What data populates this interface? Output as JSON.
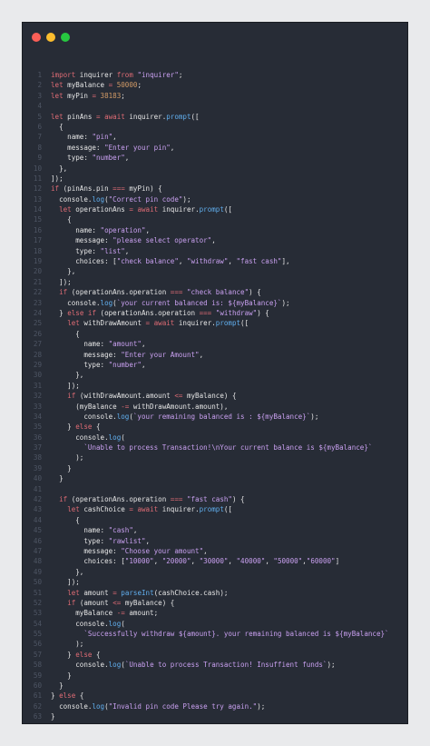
{
  "window": {
    "buttons": [
      {
        "name": "close",
        "color": "#fb5f57"
      },
      {
        "name": "minimize",
        "color": "#fbbd2e"
      },
      {
        "name": "maximize",
        "color": "#27c840"
      }
    ]
  },
  "colors": {
    "keyword": "#e06c75",
    "string": "#c9a0f0",
    "number": "#d19a66",
    "function": "#61afef",
    "text": "#e6e6e6",
    "line_number": "#4e5564",
    "background": "#272c36"
  },
  "code_lines": [
    [
      [
        "k",
        "import"
      ],
      [
        "i",
        " inquirer "
      ],
      [
        "k",
        "from"
      ],
      [
        "i",
        " "
      ],
      [
        "s",
        "\"inquirer\""
      ],
      [
        "i",
        ";"
      ]
    ],
    [
      [
        "k",
        "let"
      ],
      [
        "i",
        " myBalance "
      ],
      [
        "k",
        "="
      ],
      [
        "i",
        " "
      ],
      [
        "n",
        "50000"
      ],
      [
        "i",
        ";"
      ]
    ],
    [
      [
        "k",
        "let"
      ],
      [
        "i",
        " myPin "
      ],
      [
        "k",
        "="
      ],
      [
        "i",
        " "
      ],
      [
        "n",
        "38183"
      ],
      [
        "i",
        ";"
      ]
    ],
    [],
    [
      [
        "k",
        "let"
      ],
      [
        "i",
        " pinAns "
      ],
      [
        "k",
        "="
      ],
      [
        "i",
        " "
      ],
      [
        "k",
        "await"
      ],
      [
        "i",
        " inquirer."
      ],
      [
        "f",
        "prompt"
      ],
      [
        "i",
        "(["
      ]
    ],
    [
      [
        "i",
        "  {"
      ]
    ],
    [
      [
        "i",
        "    name: "
      ],
      [
        "s",
        "\"pin\""
      ],
      [
        "i",
        ","
      ]
    ],
    [
      [
        "i",
        "    message: "
      ],
      [
        "s",
        "\"Enter your pin\""
      ],
      [
        "i",
        ","
      ]
    ],
    [
      [
        "i",
        "    type: "
      ],
      [
        "s",
        "\"number\""
      ],
      [
        "i",
        ","
      ]
    ],
    [
      [
        "i",
        "  },"
      ]
    ],
    [
      [
        "i",
        "]);"
      ]
    ],
    [
      [
        "k",
        "if"
      ],
      [
        "i",
        " (pinAns.pin "
      ],
      [
        "k",
        "==="
      ],
      [
        "i",
        " myPin) {"
      ]
    ],
    [
      [
        "i",
        "  console."
      ],
      [
        "f",
        "log"
      ],
      [
        "i",
        "("
      ],
      [
        "s",
        "\"Correct pin code\""
      ],
      [
        "i",
        ");"
      ]
    ],
    [
      [
        "i",
        "  "
      ],
      [
        "k",
        "let"
      ],
      [
        "i",
        " operationAns "
      ],
      [
        "k",
        "="
      ],
      [
        "i",
        " "
      ],
      [
        "k",
        "await"
      ],
      [
        "i",
        " inquirer."
      ],
      [
        "f",
        "prompt"
      ],
      [
        "i",
        "(["
      ]
    ],
    [
      [
        "i",
        "    {"
      ]
    ],
    [
      [
        "i",
        "      name: "
      ],
      [
        "s",
        "\"operation\""
      ],
      [
        "i",
        ","
      ]
    ],
    [
      [
        "i",
        "      message: "
      ],
      [
        "s",
        "\"please select operator\""
      ],
      [
        "i",
        ","
      ]
    ],
    [
      [
        "i",
        "      type: "
      ],
      [
        "s",
        "\"list\""
      ],
      [
        "i",
        ","
      ]
    ],
    [
      [
        "i",
        "      choices: ["
      ],
      [
        "s",
        "\"check balance\""
      ],
      [
        "i",
        ", "
      ],
      [
        "s",
        "\"withdraw\""
      ],
      [
        "i",
        ", "
      ],
      [
        "s",
        "\"fast cash\""
      ],
      [
        "i",
        "],"
      ]
    ],
    [
      [
        "i",
        "    },"
      ]
    ],
    [
      [
        "i",
        "  ]);"
      ]
    ],
    [
      [
        "i",
        "  "
      ],
      [
        "k",
        "if"
      ],
      [
        "i",
        " (operationAns.operation "
      ],
      [
        "k",
        "==="
      ],
      [
        "i",
        " "
      ],
      [
        "s",
        "\"check balance\""
      ],
      [
        "i",
        ") {"
      ]
    ],
    [
      [
        "i",
        "    console."
      ],
      [
        "f",
        "log"
      ],
      [
        "i",
        "("
      ],
      [
        "t",
        "`your current balanced is: ${myBalance}`"
      ],
      [
        "i",
        ");"
      ]
    ],
    [
      [
        "i",
        "  } "
      ],
      [
        "k",
        "else if"
      ],
      [
        "i",
        " (operationAns.operation "
      ],
      [
        "k",
        "==="
      ],
      [
        "i",
        " "
      ],
      [
        "s",
        "\"withdraw\""
      ],
      [
        "i",
        ") {"
      ]
    ],
    [
      [
        "i",
        "    "
      ],
      [
        "k",
        "let"
      ],
      [
        "i",
        " withDrawAmount "
      ],
      [
        "k",
        "="
      ],
      [
        "i",
        " "
      ],
      [
        "k",
        "await"
      ],
      [
        "i",
        " inquirer."
      ],
      [
        "f",
        "prompt"
      ],
      [
        "i",
        "(["
      ]
    ],
    [
      [
        "i",
        "      {"
      ]
    ],
    [
      [
        "i",
        "        name: "
      ],
      [
        "s",
        "\"amount\""
      ],
      [
        "i",
        ","
      ]
    ],
    [
      [
        "i",
        "        message: "
      ],
      [
        "s",
        "\"Enter your Amount\""
      ],
      [
        "i",
        ","
      ]
    ],
    [
      [
        "i",
        "        type: "
      ],
      [
        "s",
        "\"number\""
      ],
      [
        "i",
        ","
      ]
    ],
    [
      [
        "i",
        "      },"
      ]
    ],
    [
      [
        "i",
        "    ]);"
      ]
    ],
    [
      [
        "i",
        "    "
      ],
      [
        "k",
        "if"
      ],
      [
        "i",
        " (withDrawAmount.amount "
      ],
      [
        "k",
        "<="
      ],
      [
        "i",
        " myBalance) {"
      ]
    ],
    [
      [
        "i",
        "      (myBalance "
      ],
      [
        "k",
        "-="
      ],
      [
        "i",
        " withDrawAmount.amount),"
      ]
    ],
    [
      [
        "i",
        "        console."
      ],
      [
        "f",
        "log"
      ],
      [
        "i",
        "("
      ],
      [
        "t",
        "`your remaining balanced is : ${myBalance}`"
      ],
      [
        "i",
        ");"
      ]
    ],
    [
      [
        "i",
        "    } "
      ],
      [
        "k",
        "else"
      ],
      [
        "i",
        " {"
      ]
    ],
    [
      [
        "i",
        "      console."
      ],
      [
        "f",
        "log"
      ],
      [
        "i",
        "("
      ]
    ],
    [
      [
        "i",
        "        "
      ],
      [
        "t",
        "`Unable to process Transaction!\\nYour current balance is ${myBalance}`"
      ]
    ],
    [
      [
        "i",
        "      );"
      ]
    ],
    [
      [
        "i",
        "    }"
      ]
    ],
    [
      [
        "i",
        "  }"
      ]
    ],
    [],
    [
      [
        "i",
        "  "
      ],
      [
        "k",
        "if"
      ],
      [
        "i",
        " (operationAns.operation "
      ],
      [
        "k",
        "==="
      ],
      [
        "i",
        " "
      ],
      [
        "s",
        "\"fast cash\""
      ],
      [
        "i",
        ") {"
      ]
    ],
    [
      [
        "i",
        "    "
      ],
      [
        "k",
        "let"
      ],
      [
        "i",
        " cashChoice "
      ],
      [
        "k",
        "="
      ],
      [
        "i",
        " "
      ],
      [
        "k",
        "await"
      ],
      [
        "i",
        " inquirer."
      ],
      [
        "f",
        "prompt"
      ],
      [
        "i",
        "(["
      ]
    ],
    [
      [
        "i",
        "      {"
      ]
    ],
    [
      [
        "i",
        "        name: "
      ],
      [
        "s",
        "\"cash\""
      ],
      [
        "i",
        ","
      ]
    ],
    [
      [
        "i",
        "        type: "
      ],
      [
        "s",
        "\"rawlist\""
      ],
      [
        "i",
        ","
      ]
    ],
    [
      [
        "i",
        "        message: "
      ],
      [
        "s",
        "\"Choose your amount\""
      ],
      [
        "i",
        ","
      ]
    ],
    [
      [
        "i",
        "        choices: ["
      ],
      [
        "s",
        "\"10000\""
      ],
      [
        "i",
        ", "
      ],
      [
        "s",
        "\"20000\""
      ],
      [
        "i",
        ", "
      ],
      [
        "s",
        "\"30000\""
      ],
      [
        "i",
        ", "
      ],
      [
        "s",
        "\"40000\""
      ],
      [
        "i",
        ", "
      ],
      [
        "s",
        "\"50000\""
      ],
      [
        "i",
        ","
      ],
      [
        "s",
        "\"60000\""
      ],
      [
        "i",
        "]"
      ]
    ],
    [
      [
        "i",
        "      },"
      ]
    ],
    [
      [
        "i",
        "    ]);"
      ]
    ],
    [
      [
        "i",
        "    "
      ],
      [
        "k",
        "let"
      ],
      [
        "i",
        " amount "
      ],
      [
        "k",
        "="
      ],
      [
        "i",
        " "
      ],
      [
        "f",
        "parseInt"
      ],
      [
        "i",
        "(cashChoice.cash);"
      ]
    ],
    [
      [
        "i",
        "    "
      ],
      [
        "k",
        "if"
      ],
      [
        "i",
        " (amount "
      ],
      [
        "k",
        "<="
      ],
      [
        "i",
        " myBalance) {"
      ]
    ],
    [
      [
        "i",
        "      myBalance "
      ],
      [
        "k",
        "-="
      ],
      [
        "i",
        " amount;"
      ]
    ],
    [
      [
        "i",
        "      console."
      ],
      [
        "f",
        "log"
      ],
      [
        "i",
        "("
      ]
    ],
    [
      [
        "i",
        "        "
      ],
      [
        "t",
        "`Successfully withdraw ${amount}. your remaining balanced is ${myBalance}`"
      ]
    ],
    [
      [
        "i",
        "      );"
      ]
    ],
    [
      [
        "i",
        "    } "
      ],
      [
        "k",
        "else"
      ],
      [
        "i",
        " {"
      ]
    ],
    [
      [
        "i",
        "      console."
      ],
      [
        "f",
        "log"
      ],
      [
        "i",
        "("
      ],
      [
        "t",
        "`Unable to process Transaction! Insuffient funds`"
      ],
      [
        "i",
        ");"
      ]
    ],
    [
      [
        "i",
        "    }"
      ]
    ],
    [
      [
        "i",
        "  }"
      ]
    ],
    [
      [
        "i",
        "} "
      ],
      [
        "k",
        "else"
      ],
      [
        "i",
        " {"
      ]
    ],
    [
      [
        "i",
        "  console."
      ],
      [
        "f",
        "log"
      ],
      [
        "i",
        "("
      ],
      [
        "s",
        "\"Invalid pin code Please try again.\""
      ],
      [
        "i",
        ");"
      ]
    ],
    [
      [
        "i",
        "}"
      ]
    ],
    []
  ]
}
